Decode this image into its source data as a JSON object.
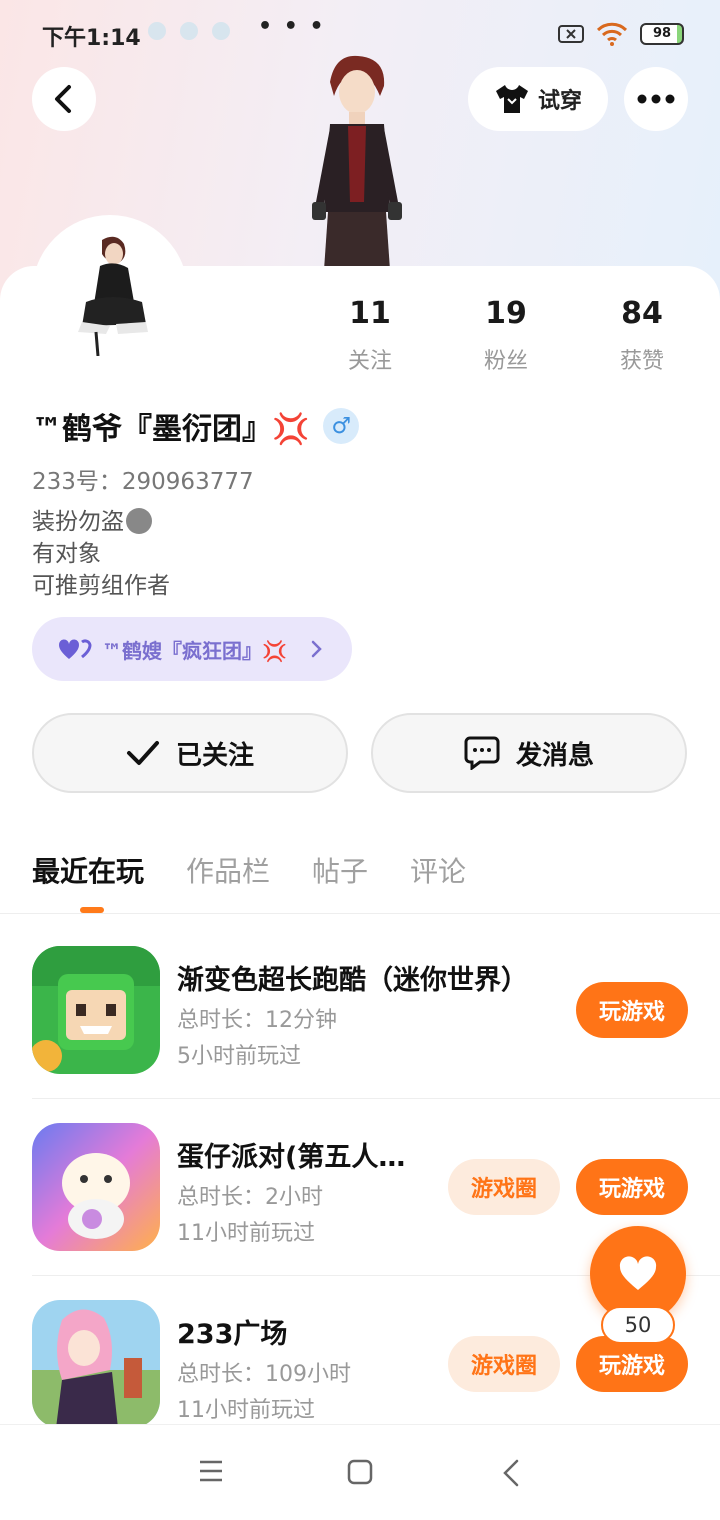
{
  "status_bar": {
    "time": "下午1:14",
    "more": "• • •",
    "battery": "98"
  },
  "header": {
    "tryon_label": "试穿"
  },
  "stats": [
    {
      "value": "11",
      "label": "关注"
    },
    {
      "value": "19",
      "label": "粉丝"
    },
    {
      "value": "84",
      "label": "获赞"
    }
  ],
  "profile": {
    "nickname": "™鹤爷『墨衍团』💢",
    "gender_symbol": "♂",
    "user_id": "233号：290963777",
    "bio": [
      "装扮勿盗",
      "有对象",
      "可推剪组作者"
    ],
    "partner": "™鹤嫂『疯狂团』💢"
  },
  "actions": {
    "follow_label": "已关注",
    "message_label": "发消息"
  },
  "tabs": [
    "最近在玩",
    "作品栏",
    "帖子",
    "评论"
  ],
  "games": [
    {
      "name": "渐变色超长跑酷（迷你世界）",
      "duration": "总时长：12分钟",
      "last_played": "5小时前玩过",
      "has_circle": false
    },
    {
      "name": "蛋仔派对(第五人…",
      "duration": "总时长：2小时",
      "last_played": "11小时前玩过",
      "has_circle": true
    },
    {
      "name": "233广场",
      "duration": "总时长：109小时",
      "last_played": "11小时前玩过",
      "has_circle": true
    }
  ],
  "game_buttons": {
    "play_label": "玩游戏",
    "circle_label": "游戏圈"
  },
  "like": {
    "count": "50"
  },
  "colors": {
    "accent": "#ff7417",
    "partner_pill": "#eae6fb",
    "gender_badge": "#d8ebfb"
  }
}
